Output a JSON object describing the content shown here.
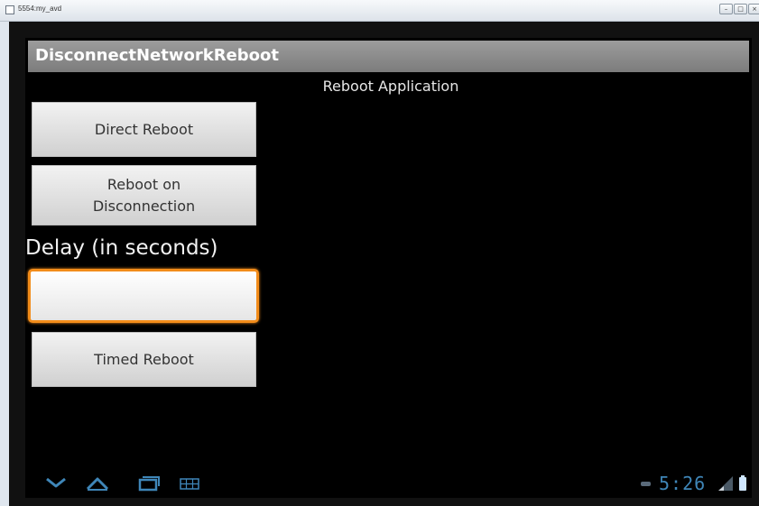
{
  "window": {
    "title": "5554:my_avd",
    "controls": [
      "minimize",
      "maximize",
      "close"
    ]
  },
  "app": {
    "title": "DisconnectNetworkReboot",
    "subtitle": "Reboot Application"
  },
  "buttons": {
    "direct_reboot": "Direct Reboot",
    "reboot_on_disconnection_line1": "Reboot on",
    "reboot_on_disconnection_line2": "Disconnection",
    "timed_reboot": "Timed Reboot"
  },
  "delay": {
    "label": "Delay (in seconds)",
    "value": "",
    "placeholder": ""
  },
  "navbar": {
    "icons": [
      "back-icon",
      "home-icon",
      "recent-apps-icon",
      "menu-icon"
    ]
  },
  "status": {
    "time": "5:26",
    "icons": [
      "sd-card-icon",
      "signal-icon",
      "battery-icon"
    ]
  },
  "colors": {
    "action_bar": "#8a8a8a",
    "background": "#000000",
    "focus_accent": "#f28c1a",
    "clock": "#3f86b8"
  }
}
